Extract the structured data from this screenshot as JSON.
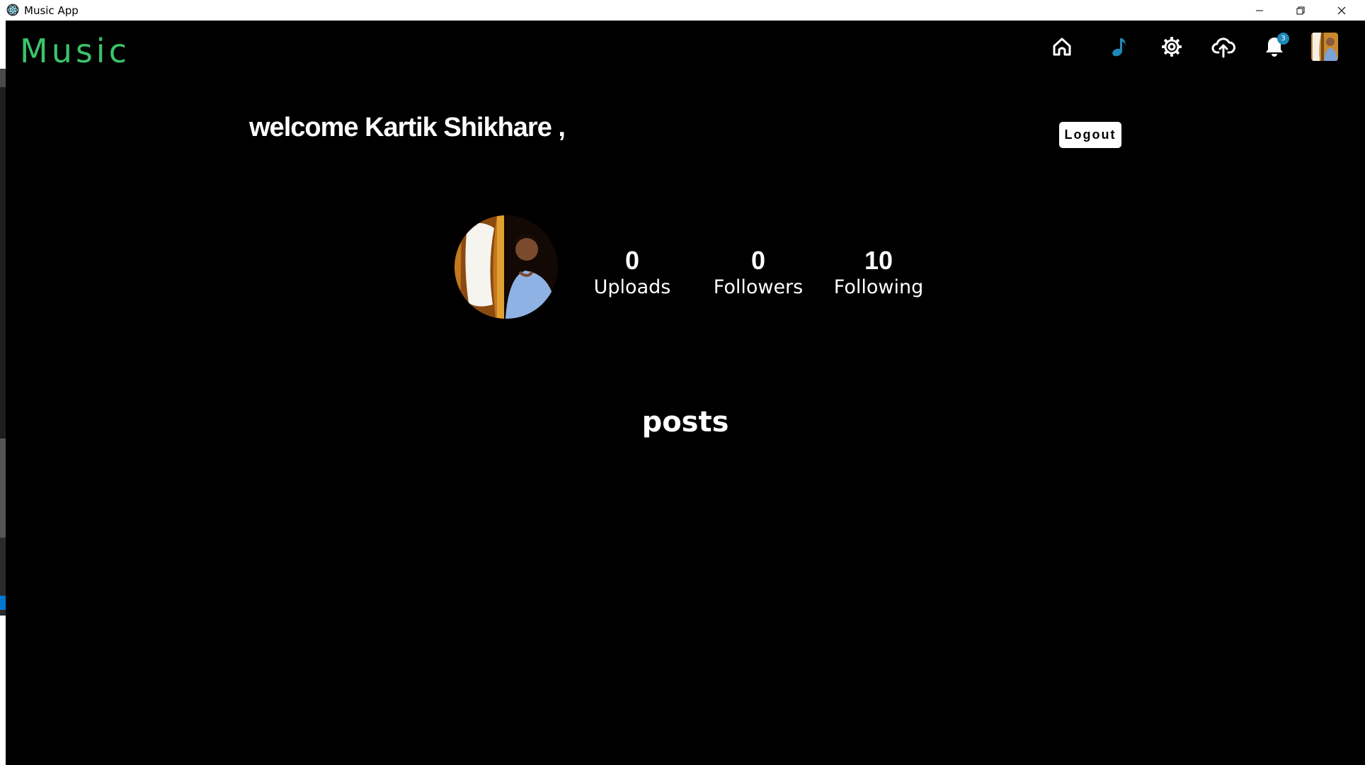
{
  "window": {
    "title": "Music App"
  },
  "header": {
    "brand": "Music",
    "nav": [
      {
        "name": "home",
        "icon": "home-icon"
      },
      {
        "name": "music",
        "icon": "music-note-icon"
      },
      {
        "name": "settings",
        "icon": "gear-icon"
      },
      {
        "name": "upload",
        "icon": "cloud-upload-icon"
      },
      {
        "name": "notifications",
        "icon": "bell-icon"
      },
      {
        "name": "profile",
        "icon": "avatar"
      }
    ],
    "notification_count": "3"
  },
  "profile": {
    "welcome_text": "welcome Kartik Shikhare ,",
    "logout_label": "Logout",
    "stats": {
      "uploads": {
        "value": "0",
        "label": "Uploads"
      },
      "followers": {
        "value": "0",
        "label": "Followers"
      },
      "following": {
        "value": "10",
        "label": "Following"
      }
    }
  },
  "posts": {
    "heading": "posts"
  },
  "colors": {
    "background": "#000000",
    "brand": "#3cc36a",
    "accent": "#1e88b8",
    "text": "#ffffff",
    "left_edge_active": "#0078d4"
  }
}
